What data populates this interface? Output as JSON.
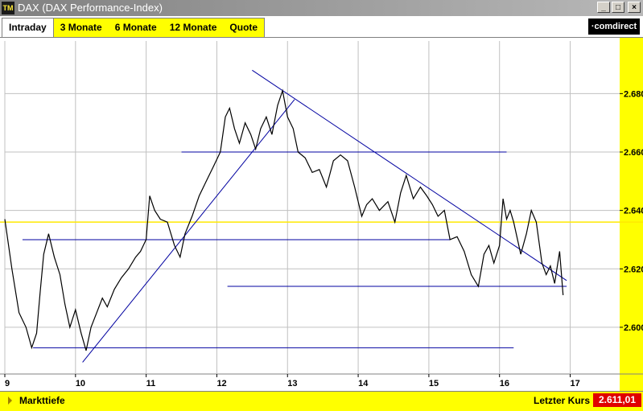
{
  "window": {
    "icon_text": "TM",
    "title": "DAX (DAX Performance-Index)",
    "buttons": [
      "_",
      "□",
      "×"
    ]
  },
  "tabs": [
    {
      "label": "Intraday",
      "active": true
    },
    {
      "label": "3 Monate",
      "active": false
    },
    {
      "label": "6 Monate",
      "active": false
    },
    {
      "label": "12 Monate",
      "active": false
    },
    {
      "label": "Quote",
      "active": false
    }
  ],
  "brand": {
    "logo_text": "·comdirect"
  },
  "status": {
    "left_label": "Markttiefe",
    "right_label": "Letzter Kurs",
    "last_price": "2.611,01"
  },
  "colors": {
    "yellow": "#ffff00",
    "trendline": "#0000a0",
    "reference_line": "#ffea00",
    "price": "#000000",
    "grid": "#c0c0c0"
  },
  "chart_data": {
    "type": "line",
    "x_ticks": [
      "9",
      "10",
      "11",
      "12",
      "13",
      "14",
      "15",
      "16",
      "17"
    ],
    "y_ticks": [
      "2.600",
      "2.620",
      "2.640",
      "2.660",
      "2.680"
    ],
    "xlim": [
      9,
      17.7
    ],
    "ylim": [
      2584,
      2698
    ],
    "reference_level": 2636,
    "horizontal_lines": [
      {
        "y": 2593,
        "x_start": 9.4,
        "x_end": 16.2
      },
      {
        "y": 2630,
        "x_start": 9.25,
        "x_end": 15.3
      },
      {
        "y": 2660,
        "x_start": 11.5,
        "x_end": 16.1
      },
      {
        "y": 2614,
        "x_start": 12.15,
        "x_end": 16.95
      }
    ],
    "trend_lines": [
      {
        "x1": 10.1,
        "y1": 2588,
        "x2": 13.1,
        "y2": 2678
      },
      {
        "x1": 12.5,
        "y1": 2688,
        "x2": 16.95,
        "y2": 2616
      }
    ],
    "series": [
      {
        "x": [
          9.0,
          9.1,
          9.2,
          9.3,
          9.38,
          9.45,
          9.5,
          9.55,
          9.62,
          9.7,
          9.78,
          9.85,
          9.92,
          10.0,
          10.08,
          10.15,
          10.22,
          10.3,
          10.38,
          10.45,
          10.55,
          10.65,
          10.75,
          10.85,
          10.92,
          11.0,
          11.05,
          11.12,
          11.2,
          11.3,
          11.4,
          11.48,
          11.55,
          11.65,
          11.75,
          11.85,
          11.95,
          12.05,
          12.12,
          12.18,
          12.25,
          12.32,
          12.4,
          12.48,
          12.55,
          12.62,
          12.7,
          12.78,
          12.86,
          12.93,
          13.0,
          13.08,
          13.15,
          13.25,
          13.35,
          13.45,
          13.55,
          13.65,
          13.75,
          13.85,
          13.95,
          14.05,
          14.12,
          14.2,
          14.3,
          14.42,
          14.52,
          14.6,
          14.68,
          14.78,
          14.88,
          14.97,
          15.05,
          15.13,
          15.22,
          15.3,
          15.4,
          15.5,
          15.6,
          15.7,
          15.78,
          15.85,
          15.92,
          16.0,
          16.05,
          16.1,
          16.15,
          16.2,
          16.3,
          16.38,
          16.45,
          16.52,
          16.6,
          16.66,
          16.72,
          16.78,
          16.85,
          16.9
        ],
        "y": [
          2637,
          2620,
          2605,
          2600,
          2593,
          2598,
          2612,
          2625,
          2632,
          2624,
          2618,
          2608,
          2600,
          2606,
          2598,
          2592,
          2600,
          2605,
          2610,
          2607,
          2613,
          2617,
          2620,
          2624,
          2626,
          2630,
          2645,
          2640,
          2637,
          2636,
          2628,
          2624,
          2632,
          2638,
          2645,
          2650,
          2655,
          2660,
          2672,
          2675,
          2668,
          2663,
          2670,
          2666,
          2661,
          2668,
          2672,
          2666,
          2676,
          2681,
          2672,
          2668,
          2660,
          2658,
          2653,
          2654,
          2648,
          2657,
          2659,
          2657,
          2648,
          2638,
          2642,
          2644,
          2640,
          2643,
          2636,
          2646,
          2652,
          2644,
          2648,
          2645,
          2642,
          2638,
          2640,
          2630,
          2631,
          2626,
          2618,
          2614,
          2625,
          2628,
          2622,
          2628,
          2644,
          2637,
          2640,
          2636,
          2625,
          2632,
          2640,
          2636,
          2622,
          2618,
          2621,
          2615,
          2626,
          2611
        ]
      }
    ]
  }
}
